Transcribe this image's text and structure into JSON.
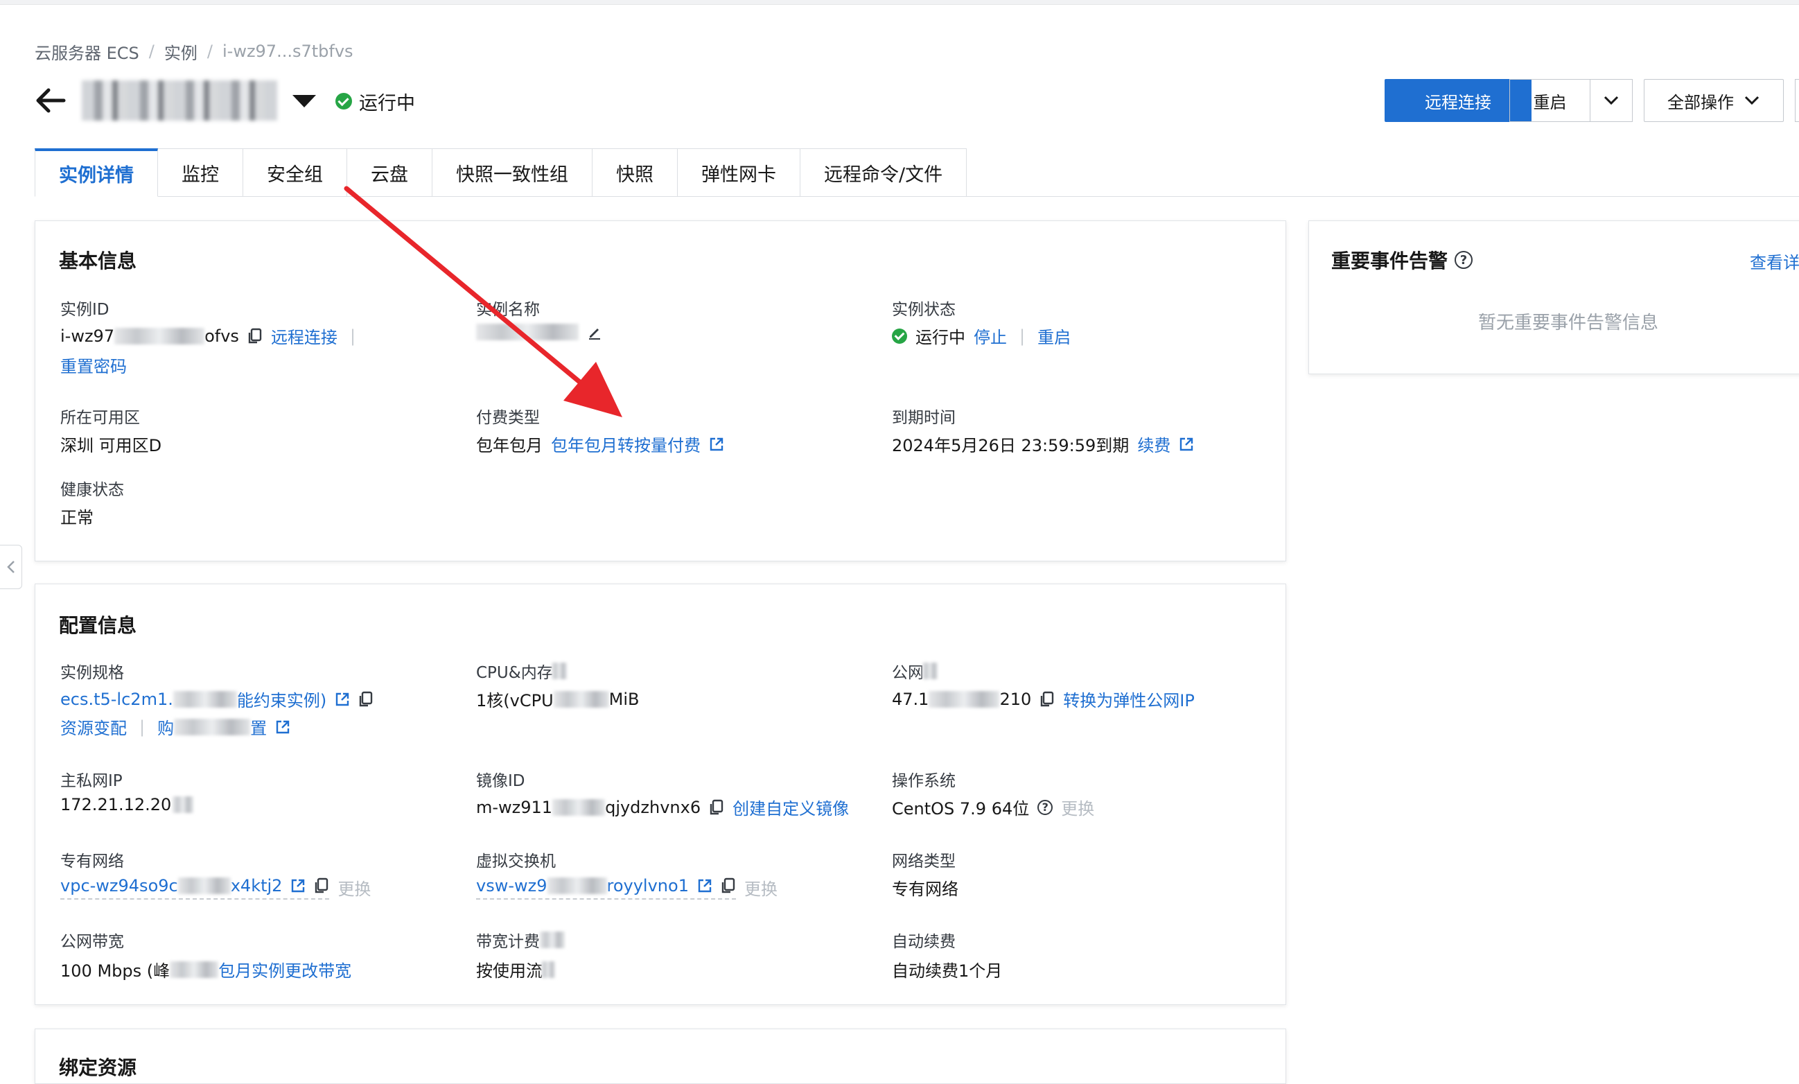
{
  "breadcrumb": {
    "items": [
      "云服务器 ECS",
      "实例",
      "i-wz97...s7tbfvs"
    ],
    "separator": "/"
  },
  "header": {
    "status": "运行中",
    "buttons": {
      "remote_connect": "远程连接",
      "restart": "重启",
      "all_actions": "全部操作"
    }
  },
  "tabs": [
    "实例详情",
    "监控",
    "安全组",
    "云盘",
    "快照一致性组",
    "快照",
    "弹性网卡",
    "远程命令/文件"
  ],
  "basic_info": {
    "title": "基本信息",
    "instance_id": {
      "label": "实例ID",
      "value_start": "i-wz97",
      "value_end": "ofvs",
      "remote_connect": "远程连接",
      "reset_password": "重置密码"
    },
    "instance_name": {
      "label": "实例名称"
    },
    "instance_status": {
      "label": "实例状态",
      "value": "运行中",
      "stop": "停止",
      "restart": "重启"
    },
    "zone": {
      "label": "所在可用区",
      "value": "深圳 可用区D"
    },
    "billing_type": {
      "label": "付费类型",
      "value": "包年包月",
      "convert_link": "包年包月转按量付费"
    },
    "expire_time": {
      "label": "到期时间",
      "value": "2024年5月26日 23:59:59到期",
      "renew": "续费"
    },
    "health": {
      "label": "健康状态",
      "value": "正常"
    }
  },
  "config_info": {
    "title": "配置信息",
    "instance_type": {
      "label": "实例规格",
      "value_start": "ecs.t5-lc2m1.",
      "value_end": "能约束实例)",
      "resize": "资源变配",
      "buy_start": "购",
      "buy_end": "置"
    },
    "cpu_mem": {
      "label_start": "CPU&内存",
      "value_start": "1核(vCPU",
      "value_end": "MiB"
    },
    "public_ip": {
      "label_start": "公网",
      "value_start": "47.1",
      "value_end": "210",
      "convert_eip": "转换为弹性公网IP"
    },
    "private_ip": {
      "label": "主私网IP",
      "value_start": "172.21.12.20"
    },
    "image_id": {
      "label": "镜像ID",
      "value_start": "m-wz911",
      "value_end": "qjydzhvnx6",
      "create_image": "创建自定义镜像"
    },
    "os": {
      "label": "操作系统",
      "value": "CentOS 7.9 64位",
      "change": "更换"
    },
    "vpc": {
      "label": "专有网络",
      "value_start": "vpc-wz94so9c",
      "value_end": "x4ktj2",
      "change": "更换"
    },
    "vswitch": {
      "label_start": "虚拟交换机",
      "value_start": "vsw-wz9",
      "value_end": "royylvno1",
      "change": "更换"
    },
    "network_type": {
      "label": "网络类型",
      "value": "专有网络"
    },
    "bandwidth": {
      "label": "公网带宽",
      "value_start": "100 Mbps (峰",
      "change_link": "包月实例更改带宽"
    },
    "bandwidth_billing": {
      "label_start": "带宽计费",
      "value_start": "按使用流"
    },
    "auto_renew": {
      "label": "自动续费",
      "value": "自动续费1个月"
    }
  },
  "bind_resources": {
    "title": "绑定资源"
  },
  "events": {
    "title": "重要事件告警",
    "view_link": "查看详",
    "empty": "暂无重要事件告警信息"
  },
  "colors": {
    "primary": "#1f6fd1",
    "success": "#26a545",
    "annotation_arrow": "#e8262b"
  }
}
